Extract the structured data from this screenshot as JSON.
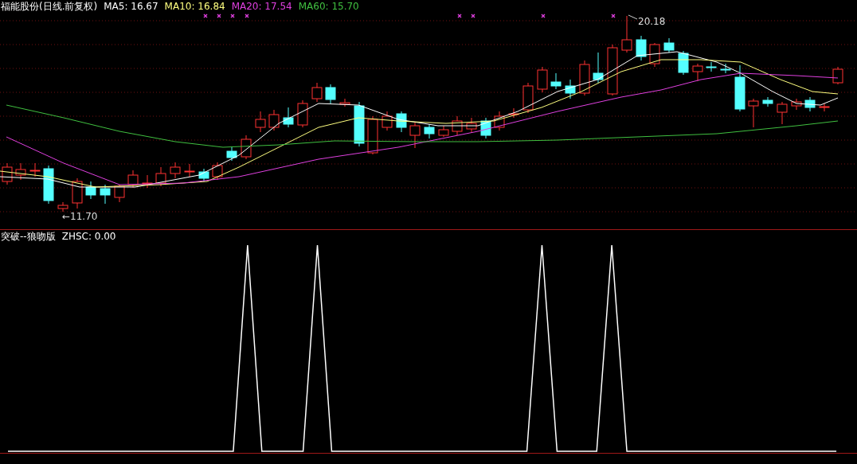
{
  "price_panel": {
    "title": "福能股份(日线.前复权)",
    "moving_averages": [
      {
        "label": "MA5: 16.67",
        "color": "#ffffff"
      },
      {
        "label": "MA10: 16.84",
        "color": "#ffff80"
      },
      {
        "label": "MA20: 17.54",
        "color": "#e040e0"
      },
      {
        "label": "MA60: 15.70",
        "color": "#40c040"
      }
    ],
    "annotations": [
      {
        "kind": "high",
        "text": "20.18"
      },
      {
        "kind": "low",
        "text": "←11.70"
      }
    ]
  },
  "indicator_panel": {
    "title": "突破--狼吻版",
    "reading": "ZHSC: 0.00"
  }
}
